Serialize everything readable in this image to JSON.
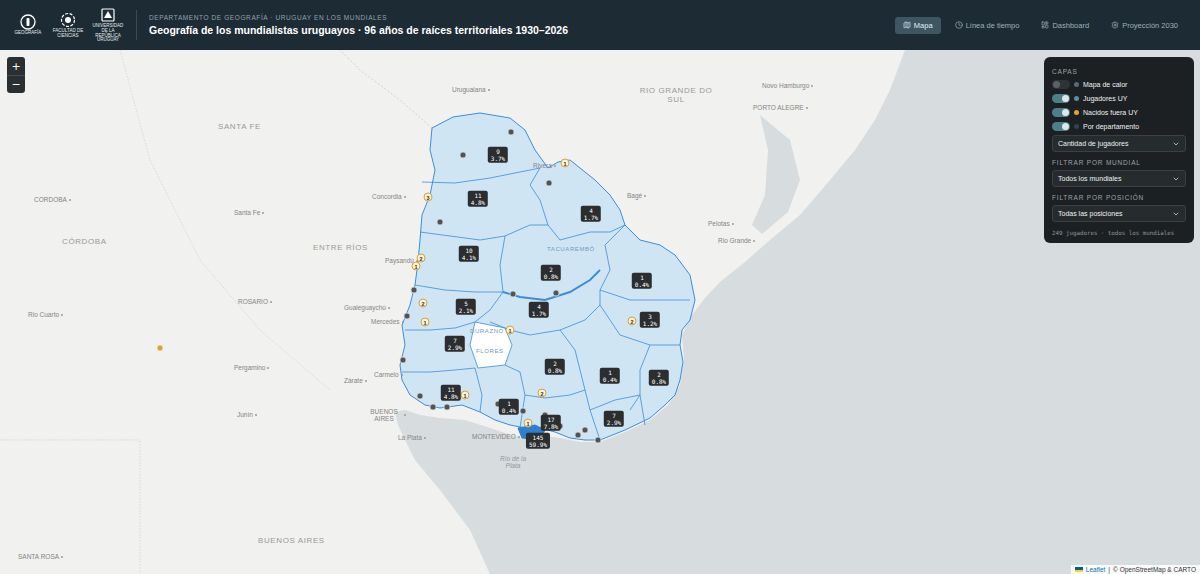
{
  "header": {
    "logos": [
      {
        "caption": "GEOGRAFÍA"
      },
      {
        "caption": "FACULTAD DE CIENCIAS"
      },
      {
        "caption": "UNIVERSIDAD DE LA REPÚBLICA URUGUAY"
      }
    ],
    "org": "DEPARTAMENTO DE GEOGRAFÍA · URUGUAY EN LOS MUNDIALES",
    "title": "Geografía de los mundialistas uruguayos · 96 años de raíces territoriales 1930–2026"
  },
  "nav": [
    {
      "label": "Mapa",
      "selected": true
    },
    {
      "label": "Línea de tiempo",
      "selected": false
    },
    {
      "label": "Dashboard",
      "selected": false
    },
    {
      "label": "Proyección 2030",
      "selected": false
    }
  ],
  "zoom": [
    "+",
    "−"
  ],
  "panel": {
    "title": "CAPAS",
    "layers": [
      {
        "label": "Mapa de calor",
        "on": false,
        "color": "#5b6b73"
      },
      {
        "label": "Jugadores UY",
        "on": true,
        "color": "#5a8da3"
      },
      {
        "label": "Nacidos fuera UY",
        "on": true,
        "color": "#e0a43a"
      },
      {
        "label": "Por departamento",
        "on": true,
        "color": "#33434a"
      }
    ],
    "metric": {
      "value": "Cantidad de jugadores"
    },
    "filters": [
      {
        "label": "FILTRAR POR MUNDIAL",
        "value": "Todos los mundiales"
      },
      {
        "label": "FILTRAR POR POSICIÓN",
        "value": "Todas las posiciones"
      }
    ],
    "summary": "249 jugadores · todos los mundiales"
  },
  "map": {
    "places": [
      {
        "name": "SANTA FE",
        "kind": "region"
      },
      {
        "name": "Santa Fe",
        "kind": "city"
      },
      {
        "name": "CORDOBA",
        "kind": "capital"
      },
      {
        "name": "CÓRDOBA",
        "kind": "region"
      },
      {
        "name": "ENTRE RÍOS",
        "kind": "region"
      },
      {
        "name": "Concordia",
        "kind": "city"
      },
      {
        "name": "Uruguaiana",
        "kind": "city"
      },
      {
        "name": "RIO GRANDE DO SUL",
        "kind": "region"
      },
      {
        "name": "Novo Hamburgo",
        "kind": "city"
      },
      {
        "name": "PORTO ALEGRE",
        "kind": "capital"
      },
      {
        "name": "Bagé",
        "kind": "city"
      },
      {
        "name": "Pelotas",
        "kind": "city"
      },
      {
        "name": "Rio Grande",
        "kind": "city"
      },
      {
        "name": "Rivera",
        "kind": "city"
      },
      {
        "name": "Paysandú",
        "kind": "city"
      },
      {
        "name": "ROSARIO",
        "kind": "capital"
      },
      {
        "name": "Gualeguaychú",
        "kind": "city"
      },
      {
        "name": "Mercedes",
        "kind": "city"
      },
      {
        "name": "Rio Cuarto",
        "kind": "city"
      },
      {
        "name": "Pergamino",
        "kind": "city"
      },
      {
        "name": "Zárate",
        "kind": "city"
      },
      {
        "name": "Carmelo",
        "kind": "city"
      },
      {
        "name": "Junín",
        "kind": "city"
      },
      {
        "name": "BUENOS AIRES",
        "kind": "capital"
      },
      {
        "name": "La Plata",
        "kind": "city"
      },
      {
        "name": "MONTEVIDEO",
        "kind": "capital"
      },
      {
        "name": "Río de la Plata",
        "kind": "water"
      },
      {
        "name": "BUENOS AIRES",
        "kind": "region"
      },
      {
        "name": "SANTA ROSA",
        "kind": "capital"
      },
      {
        "name": "TACUAREMBÓ",
        "kind": "dept"
      },
      {
        "name": "DURAZNO",
        "kind": "dept"
      },
      {
        "name": "FLORES",
        "kind": "dept"
      }
    ],
    "departments": [
      {
        "count": "9",
        "share": "3.7%"
      },
      {
        "count": "11",
        "share": "4.8%"
      },
      {
        "count": "4",
        "share": "1.7%"
      },
      {
        "count": "10",
        "share": "4.1%"
      },
      {
        "count": "2",
        "share": "0.8%"
      },
      {
        "count": "1",
        "share": "0.4%"
      },
      {
        "count": "5",
        "share": "2.1%"
      },
      {
        "count": "4",
        "share": "1.7%"
      },
      {
        "count": "3",
        "share": "1.2%"
      },
      {
        "count": "7",
        "share": "2.9%"
      },
      {
        "count": "2",
        "share": "0.8%"
      },
      {
        "count": "1",
        "share": "0.4%"
      },
      {
        "count": "2",
        "share": "0.8%"
      },
      {
        "count": "11",
        "share": "4.8%"
      },
      {
        "count": "1",
        "share": "0.4%"
      },
      {
        "count": "17",
        "share": "7.8%"
      },
      {
        "count": "7",
        "share": "2.9%"
      },
      {
        "count": "145",
        "share": "59.9%"
      }
    ],
    "abroad_markers": [
      {
        "count": "1"
      },
      {
        "count": "3"
      },
      {
        "count": "2"
      },
      {
        "count": "1"
      },
      {
        "count": "2"
      },
      {
        "count": "1"
      },
      {
        "count": "1"
      },
      {
        "count": "2"
      },
      {
        "count": "2"
      },
      {
        "count": "1"
      },
      {
        "count": "1"
      }
    ]
  },
  "attribution": {
    "link": "Leaflet",
    "separator": "|",
    "credit": "© OpenStreetMap & CARTO"
  }
}
